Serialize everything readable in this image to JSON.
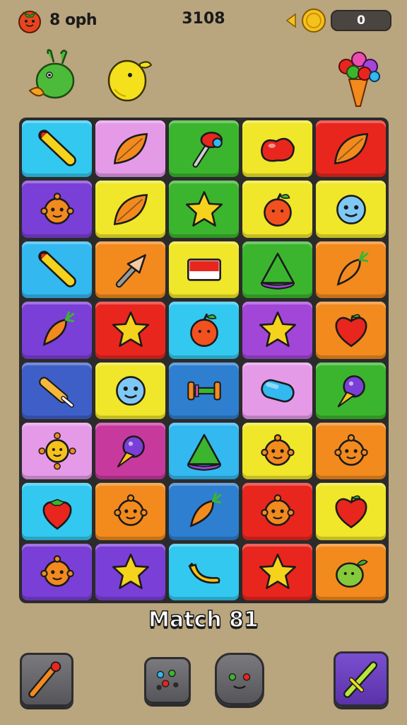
{
  "hud": {
    "lives_label": "8 oph",
    "score": "3108",
    "coin_count": "0"
  },
  "board": {
    "rows": [
      [
        {
          "color": "#33c8f0",
          "icon": "corn-icon"
        },
        {
          "color": "#e59ae8",
          "icon": "leaf-icon"
        },
        {
          "color": "#3bb52e",
          "icon": "hammer-icon"
        },
        {
          "color": "#f0e62a",
          "icon": "bean-icon"
        },
        {
          "color": "#e8261e",
          "icon": "leaf-icon"
        }
      ],
      [
        {
          "color": "#7a3fd6",
          "icon": "monster-icon"
        },
        {
          "color": "#f0e62a",
          "icon": "leaf-icon"
        },
        {
          "color": "#3bb52e",
          "icon": "star-icon"
        },
        {
          "color": "#f0e62a",
          "icon": "apple-icon"
        },
        {
          "color": "#f0e62a",
          "icon": "smiley-icon"
        }
      ],
      [
        {
          "color": "#33b8f0",
          "icon": "corn-icon"
        },
        {
          "color": "#f28a1e",
          "icon": "arrow-icon"
        },
        {
          "color": "#f0e62a",
          "icon": "block-icon"
        },
        {
          "color": "#3bb52e",
          "icon": "cone-icon"
        },
        {
          "color": "#f28a1e",
          "icon": "carrot-icon"
        }
      ],
      [
        {
          "color": "#7a3fd6",
          "icon": "carrot-icon"
        },
        {
          "color": "#e8261e",
          "icon": "star-icon"
        },
        {
          "color": "#33c8f0",
          "icon": "apple-icon"
        },
        {
          "color": "#a246d8",
          "icon": "star-icon"
        },
        {
          "color": "#f28a1e",
          "icon": "heart-icon"
        }
      ],
      [
        {
          "color": "#3f5fc8",
          "icon": "popsicle-icon"
        },
        {
          "color": "#f0e62a",
          "icon": "smiley-icon"
        },
        {
          "color": "#2e7fd0",
          "icon": "dumbbell-icon"
        },
        {
          "color": "#e59ae8",
          "icon": "capsule-icon"
        },
        {
          "color": "#3bb52e",
          "icon": "icecream-icon"
        }
      ],
      [
        {
          "color": "#e59ae8",
          "icon": "sun-icon"
        },
        {
          "color": "#c8399e",
          "icon": "icecream-icon"
        },
        {
          "color": "#33b8f0",
          "icon": "cone-icon"
        },
        {
          "color": "#f0e62a",
          "icon": "monster-icon"
        },
        {
          "color": "#f28a1e",
          "icon": "monster-icon"
        }
      ],
      [
        {
          "color": "#33c8f0",
          "icon": "strawberry-icon"
        },
        {
          "color": "#f28a1e",
          "icon": "monster-icon"
        },
        {
          "color": "#2e7fd0",
          "icon": "carrot-icon"
        },
        {
          "color": "#e8261e",
          "icon": "monster-icon"
        },
        {
          "color": "#f0e62a",
          "icon": "heart-icon"
        }
      ],
      [
        {
          "color": "#7a3fd6",
          "icon": "monster-icon"
        },
        {
          "color": "#7a3fd6",
          "icon": "star-icon"
        },
        {
          "color": "#33c8f0",
          "icon": "banana-icon"
        },
        {
          "color": "#e8261e",
          "icon": "star-icon"
        },
        {
          "color": "#f28a1e",
          "icon": "berry-icon"
        }
      ]
    ]
  },
  "footer": {
    "match_label": "Match 81"
  }
}
